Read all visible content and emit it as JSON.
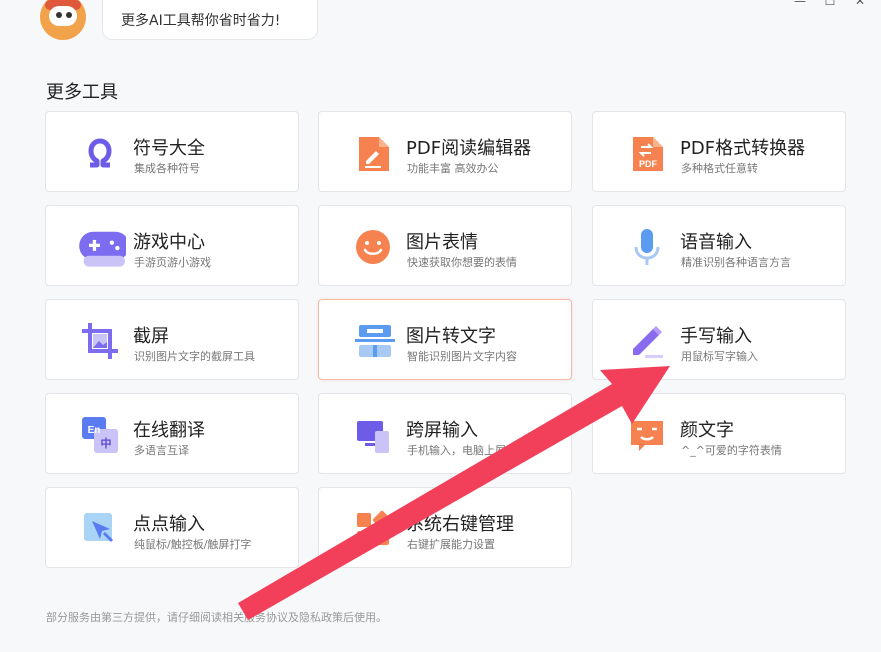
{
  "window": {
    "minimize_glyph": "—",
    "maximize_glyph": "☐",
    "close_glyph": "✕"
  },
  "header": {
    "bubble_text": "更多AI工具帮你省时省力!"
  },
  "section_title": "更多工具",
  "cards": [
    {
      "title": "符号大全",
      "sub": "集成各种符号",
      "icon": "omega-icon"
    },
    {
      "title": "PDF阅读编辑器",
      "sub": "功能丰富 高效办公",
      "icon": "pdf-edit-icon"
    },
    {
      "title": "PDF格式转换器",
      "sub": "多种格式任意转",
      "icon": "pdf-convert-icon"
    },
    {
      "title": "游戏中心",
      "sub": "手游页游小游戏",
      "icon": "gamepad-icon"
    },
    {
      "title": "图片表情",
      "sub": "快速获取你想要的表情",
      "icon": "smiley-icon"
    },
    {
      "title": "语音输入",
      "sub": "精准识别各种语言方言",
      "icon": "microphone-icon"
    },
    {
      "title": "截屏",
      "sub": "识别图片文字的截屏工具",
      "icon": "crop-screenshot-icon"
    },
    {
      "title": "图片转文字",
      "sub": "智能识别图片文字内容",
      "icon": "scan-text-icon"
    },
    {
      "title": "手写输入",
      "sub": "用鼠标写字输入",
      "icon": "pencil-icon"
    },
    {
      "title": "在线翻译",
      "sub": "多语言互译",
      "icon": "translate-icon",
      "icon_text_en": "En",
      "icon_text_zh": "中"
    },
    {
      "title": "跨屏输入",
      "sub": "手机输入，电脑上屏",
      "icon": "cross-screen-icon"
    },
    {
      "title": "颜文字",
      "sub": "^_^可爱的字符表情",
      "icon": "kaomoji-icon"
    },
    {
      "title": "点点输入",
      "sub": "纯鼠标/触控板/触屏打字",
      "icon": "cursor-click-icon"
    },
    {
      "title": "系统右键管理",
      "sub": "右键扩展能力设置",
      "icon": "grid-blocks-icon"
    }
  ],
  "footer": "部分服务由第三方提供，请仔细阅读相关服务协议及隐私政策后使用。",
  "colors": {
    "accent_orange": "#f5824f",
    "accent_purple": "#7b6cf0",
    "accent_blue": "#5b9bf0",
    "arrow_red": "#f2405a"
  }
}
